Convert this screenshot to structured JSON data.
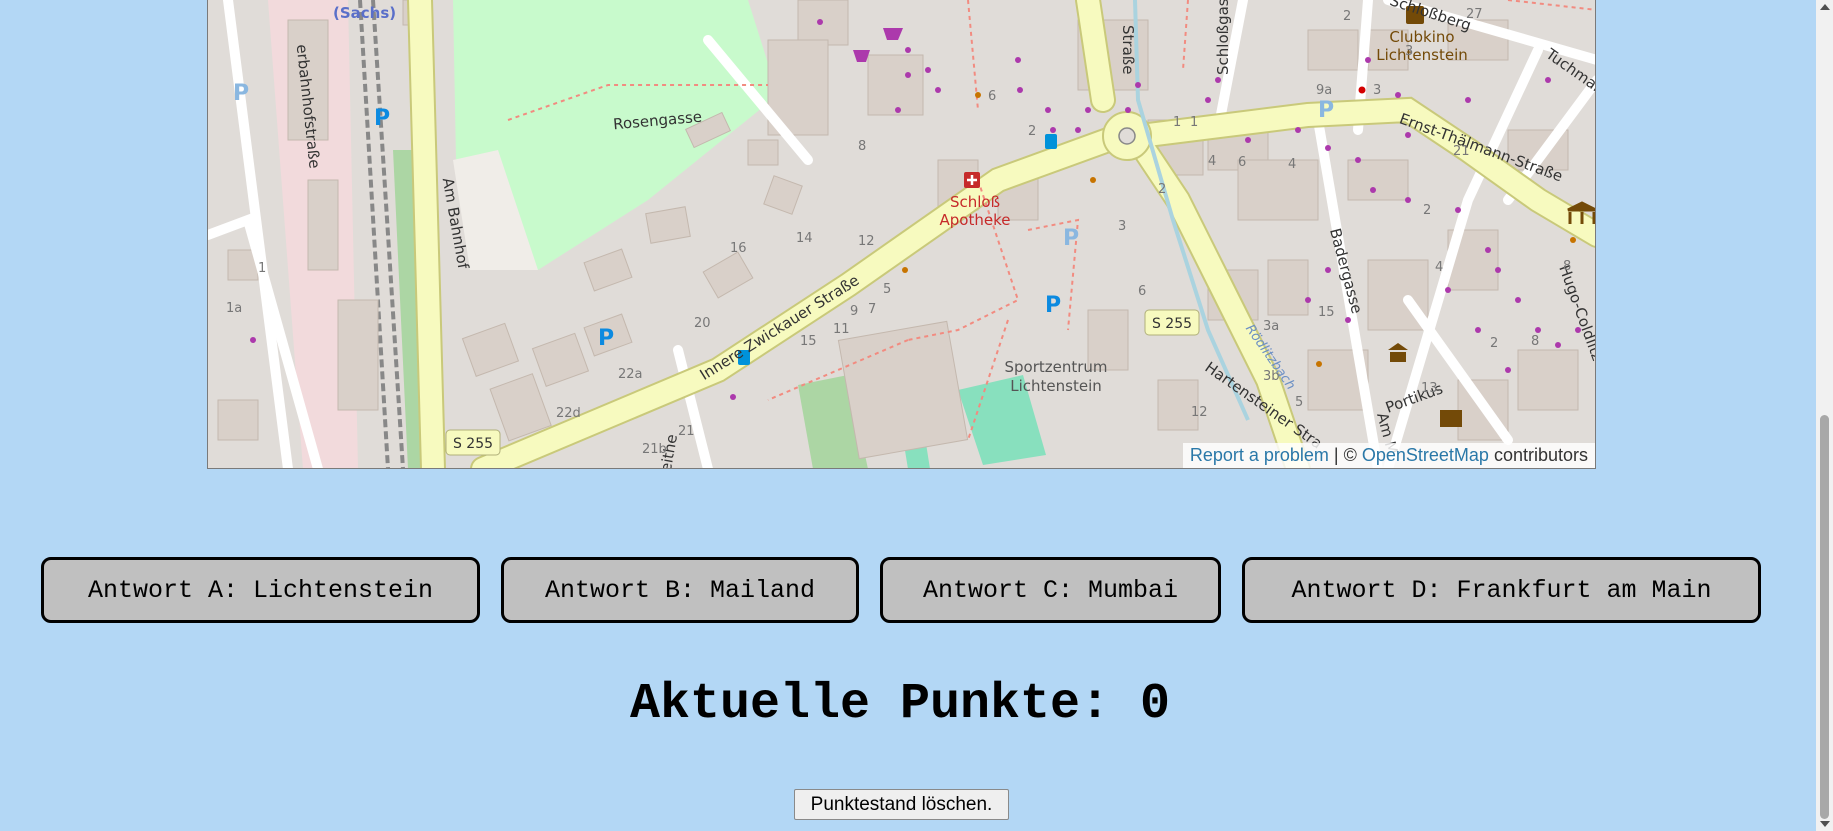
{
  "map": {
    "street_labels": {
      "rosengasse": "Rosengasse",
      "am_bahnhof": "Am Bahnhof",
      "bahnhofstrasse": "erbahnhofstraße",
      "innere_zwickauer": "Innere Zwickauer Straße",
      "ernst_thaelmann": "Ernst-Thälmann-Straße",
      "hugo_coldlitz": "Hugo-Coldlitz-Straße",
      "schlossberg": "Schloßberg",
      "schlossgasse": "Schloßgasse",
      "badergasse": "Badergasse",
      "hartensteiner": "Hartensteiner Stra",
      "tuchmarkt": "Tuchmarkt",
      "strasse": "Straße",
      "kreuzleithe": "reuzleithe",
      "rodlitzbach": "Rödlitzbach",
      "am_m": "Am M",
      "portikus": "Portikus",
      "sachs": "(Sachs)"
    },
    "road_badges": {
      "s255_left": "S 255",
      "s255_right": "S 255"
    },
    "poi": {
      "schloss_apotheke": [
        "Schloß",
        "Apotheke"
      ],
      "clubkino": [
        "Clubkino",
        "Lichtenstein"
      ],
      "sportzentrum": [
        "Sportzentrum",
        "Lichtenstein"
      ]
    },
    "house_numbers": [
      "1",
      "1a",
      "8",
      "16",
      "14",
      "12",
      "20",
      "22a",
      "22d",
      "21b",
      "21",
      "15",
      "11",
      "9",
      "7",
      "5",
      "6",
      "3",
      "2",
      "4",
      "3a",
      "3b",
      "5",
      "12",
      "13",
      "15",
      "9a",
      "21",
      "27",
      "2",
      "3",
      "4",
      "6",
      "8",
      "2",
      "1",
      "1",
      "2",
      "3",
      "6",
      "2",
      "4",
      "8"
    ],
    "attribution": {
      "report": "Report a problem",
      "sep": " | © ",
      "osm": "OpenStreetMap",
      "contributors": " contributors"
    }
  },
  "answers": {
    "a": "Antwort A: Lichtenstein",
    "b": "Antwort B: Mailand",
    "c": "Antwort C: Mumbai",
    "d": "Antwort D: Frankfurt am Main"
  },
  "score_label": "Aktuelle Punkte: 0",
  "reset_label": "Punktestand löschen.",
  "colors": {
    "background": "#b3d7f5",
    "button_bg": "#c0c0c0",
    "road_main": "#f7fabf",
    "park": "#c8facc",
    "building": "#d9d0c9",
    "railway_area": "#f2dadc",
    "poi_red": "#c62a2a",
    "poi_brown": "#734a08",
    "parking_blue": "#0c8ae0"
  }
}
